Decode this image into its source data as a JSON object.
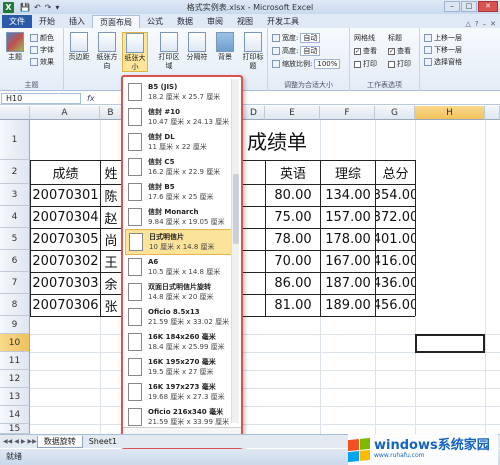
{
  "window": {
    "title": "格式实例表.xlsx - Microsoft Excel",
    "minimize": "–",
    "maximize": "□",
    "close": "✕"
  },
  "qat": {
    "save": "💾",
    "undo": "↶",
    "redo": "↷",
    "more": "▾"
  },
  "tabs": [
    "文件",
    "开始",
    "插入",
    "页面布局",
    "公式",
    "数据",
    "审阅",
    "视图",
    "开发工具"
  ],
  "ribbon": {
    "themes": {
      "label": "主题",
      "colors": "颜色",
      "fonts": "字体",
      "effects": "效果",
      "group": "主题"
    },
    "margins": "页边距",
    "orientation": "纸张方向",
    "size": "纸张大小",
    "print_area": "打印区域",
    "breaks": "分隔符",
    "background": "背景",
    "print_titles": "打印标题",
    "width_label": "宽度:",
    "width_value": "自动",
    "height_label": "高度:",
    "height_value": "自动",
    "scale_label": "缩放比例:",
    "scale_value": "100%",
    "scale_group": "调整为合适大小",
    "gridlines": "网格线",
    "headings": "标题",
    "view": "查看",
    "print": "打印",
    "sheet_options_group": "工作表选项",
    "bring_forward": "上移一层",
    "send_backward": "下移一层",
    "selection_pane": "选择窗格"
  },
  "formula_bar": {
    "name_box": "H10",
    "fx": "fx"
  },
  "sheet": {
    "columns": [
      "A",
      "B",
      "C",
      "D",
      "E",
      "F",
      "G",
      "H"
    ],
    "selected_column": "H",
    "rows": [
      "1",
      "2",
      "3",
      "4",
      "5",
      "6",
      "7",
      "8",
      "9",
      "10",
      "11",
      "12",
      "13",
      "14",
      "15",
      "16",
      "17"
    ],
    "selected_row": "10",
    "title": "成绩单",
    "headers": [
      "成绩",
      "姓",
      "",
      "",
      "英语",
      "理综",
      "总分"
    ],
    "data": [
      [
        "20070301",
        "陈",
        "",
        "",
        "80.00",
        "134.00",
        "354.00"
      ],
      [
        "20070304",
        "赵",
        "",
        "",
        "75.00",
        "157.00",
        "372.00"
      ],
      [
        "20070305",
        "尚",
        "",
        "",
        "78.00",
        "178.00",
        "401.00"
      ],
      [
        "20070302",
        "王",
        "",
        "",
        "70.00",
        "167.00",
        "416.00"
      ],
      [
        "20070303",
        "余",
        "",
        "",
        "86.00",
        "187.00",
        "436.00"
      ],
      [
        "20070306",
        "张",
        "",
        "",
        "81.00",
        "189.00",
        "456.00"
      ]
    ]
  },
  "paper_menu": {
    "items": [
      {
        "name": "B5 (JIS)",
        "size": "18.2 厘米 x 25.7 厘米"
      },
      {
        "name": "信封 #10",
        "size": "10.47 厘米 x 24.13 厘米"
      },
      {
        "name": "信封 DL",
        "size": "11 厘米 x 22 厘米"
      },
      {
        "name": "信封 C5",
        "size": "16.2 厘米 x 22.9 厘米"
      },
      {
        "name": "信封 B5",
        "size": "17.6 厘米 x 25 厘米"
      },
      {
        "name": "信封 Monarch",
        "size": "9.84 厘米 x 19.05 厘米"
      },
      {
        "name": "日式明信片",
        "size": "10 厘米 x 14.8 厘米"
      },
      {
        "name": "A6",
        "size": "10.5 厘米 x 14.8 厘米"
      },
      {
        "name": "双面日式明信片旋转",
        "size": "14.8 厘米 x 20 厘米"
      },
      {
        "name": "Oficio 8.5x13",
        "size": "21.59 厘米 x 33.02 厘米"
      },
      {
        "name": "16K 184x260 毫米",
        "size": "18.4 厘米 x 25.99 厘米"
      },
      {
        "name": "16K 195x270 毫米",
        "size": "19.5 厘米 x 27 厘米"
      },
      {
        "name": "16K 197x273 毫米",
        "size": "19.68 厘米 x 27.3 厘米"
      },
      {
        "name": "Oficio 216x340 毫米",
        "size": "21.59 厘米 x 33.99 厘米"
      }
    ],
    "selected_index": 6,
    "more": "其他纸张大小(M)..."
  },
  "sheet_tabs": {
    "nav": [
      "◀◀",
      "◀",
      "▶",
      "▶▶"
    ],
    "tabs": [
      "数据旋转",
      "Sheet1"
    ]
  },
  "status": {
    "text": "就绪"
  },
  "watermark": {
    "main": "windows系统家园",
    "sub": "www.ruhafu.com"
  },
  "colors": {
    "file_tab": "#2a5aa8",
    "menu_border": "#d9534f",
    "highlight": "#fce39a"
  }
}
